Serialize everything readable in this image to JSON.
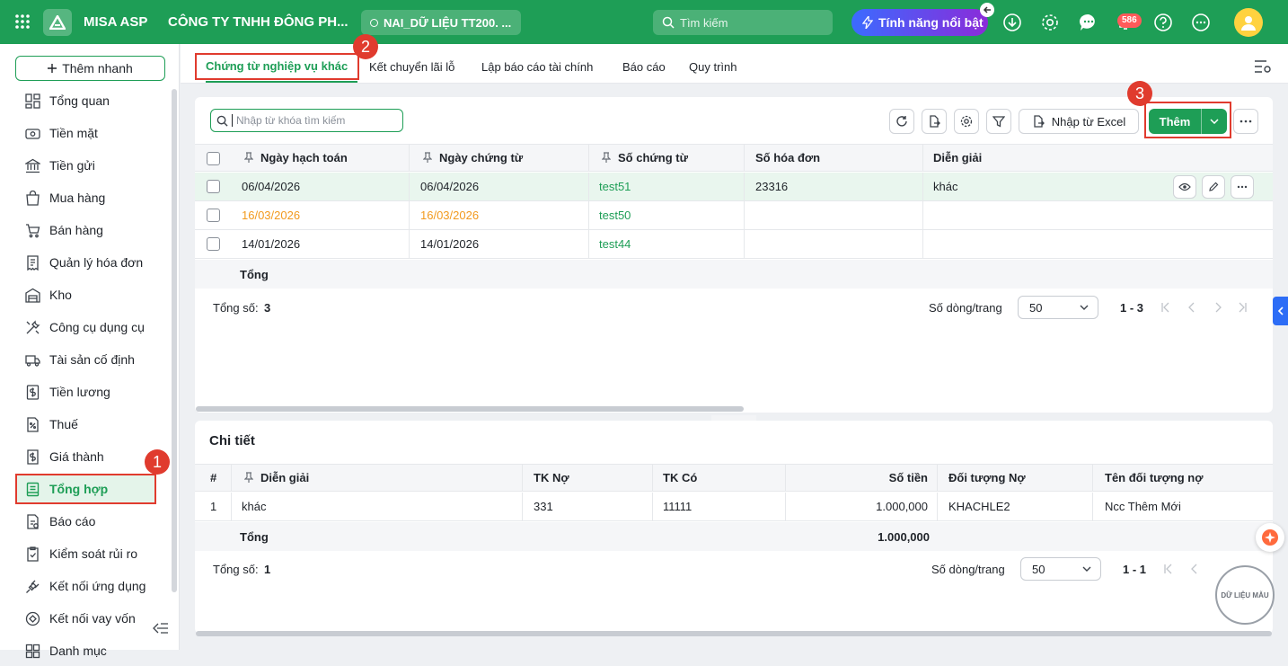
{
  "topbar": {
    "app_name": "MISA ASP",
    "company": "CÔNG TY TNHH ĐÔNG PH...",
    "database": "NAI_DỮ LIỆU TT200. ...",
    "search_placeholder": "Tìm kiếm",
    "featured_label": "Tính năng nổi bật",
    "notification_count": "586",
    "brand_color": "#1e9e56"
  },
  "sidebar": {
    "quick_add": "Thêm nhanh",
    "items": [
      {
        "label": "Tổng quan",
        "icon": "dashboard-icon"
      },
      {
        "label": "Tiền mặt",
        "icon": "cash-icon"
      },
      {
        "label": "Tiền gửi",
        "icon": "bank-icon"
      },
      {
        "label": "Mua hàng",
        "icon": "shopping-bag-icon"
      },
      {
        "label": "Bán hàng",
        "icon": "cart-icon"
      },
      {
        "label": "Quản lý hóa đơn",
        "icon": "invoice-icon"
      },
      {
        "label": "Kho",
        "icon": "warehouse-icon"
      },
      {
        "label": "Công cụ dụng cụ",
        "icon": "tools-icon"
      },
      {
        "label": "Tài sản cố định",
        "icon": "truck-icon"
      },
      {
        "label": "Tiền lương",
        "icon": "salary-icon"
      },
      {
        "label": "Thuế",
        "icon": "tax-icon"
      },
      {
        "label": "Giá thành",
        "icon": "cost-icon"
      },
      {
        "label": "Tổng hợp",
        "icon": "ledger-icon"
      },
      {
        "label": "Báo cáo",
        "icon": "report-icon"
      },
      {
        "label": "Kiểm soát rủi ro",
        "icon": "risk-icon"
      },
      {
        "label": "Kết nối ứng dụng",
        "icon": "plug-icon"
      },
      {
        "label": "Kết nối vay vốn",
        "icon": "loan-icon"
      },
      {
        "label": "Danh mục",
        "icon": "category-icon"
      }
    ],
    "active_item": "Tổng hợp"
  },
  "tabs": [
    "Chứng từ nghiệp vụ khác",
    "Kết chuyển lãi lỗ",
    "Lập báo cáo tài chính",
    "Báo cáo",
    "Quy trình"
  ],
  "toolbar": {
    "search_placeholder": "Nhập từ khóa tìm kiếm",
    "import_excel": "Nhập từ Excel",
    "add": "Thêm"
  },
  "master_table": {
    "columns": [
      "Ngày hạch toán",
      "Ngày chứng từ",
      "Số chứng từ",
      "Số hóa đơn",
      "Diễn giải"
    ],
    "rows": [
      {
        "posting_date": "06/04/2026",
        "doc_date": "06/04/2026",
        "doc_no": "test51",
        "invoice_no": "23316",
        "desc": "khác"
      },
      {
        "posting_date": "16/03/2026",
        "doc_date": "16/03/2026",
        "doc_no": "test50",
        "invoice_no": "",
        "desc": ""
      },
      {
        "posting_date": "14/01/2026",
        "doc_date": "14/01/2026",
        "doc_no": "test44",
        "invoice_no": "",
        "desc": ""
      }
    ],
    "total_label": "Tổng",
    "count_label": "Tổng số:",
    "count": "3",
    "rows_per_page_label": "Số dòng/trang",
    "rows_per_page": "50",
    "range": "1 - 3"
  },
  "detail": {
    "title": "Chi tiết",
    "columns": [
      "#",
      "Diễn giải",
      "TK Nợ",
      "TK Có",
      "Số tiền",
      "Đối tượng Nợ",
      "Tên đối tượng nợ"
    ],
    "rows": [
      {
        "idx": "1",
        "desc": "khác",
        "debit": "331",
        "credit": "11111",
        "amount": "1.000,000",
        "debtor": "KHACHLE2",
        "debtor_name": "Ncc Thêm Mới"
      }
    ],
    "total_label": "Tổng",
    "total_amount": "1.000,000",
    "count_label": "Tổng số:",
    "count": "1",
    "rows_per_page_label": "Số dòng/trang",
    "rows_per_page": "50",
    "range": "1 - 1"
  },
  "callouts": [
    "1",
    "2",
    "3"
  ],
  "watermark": "DỮ LIỆU MẪU"
}
